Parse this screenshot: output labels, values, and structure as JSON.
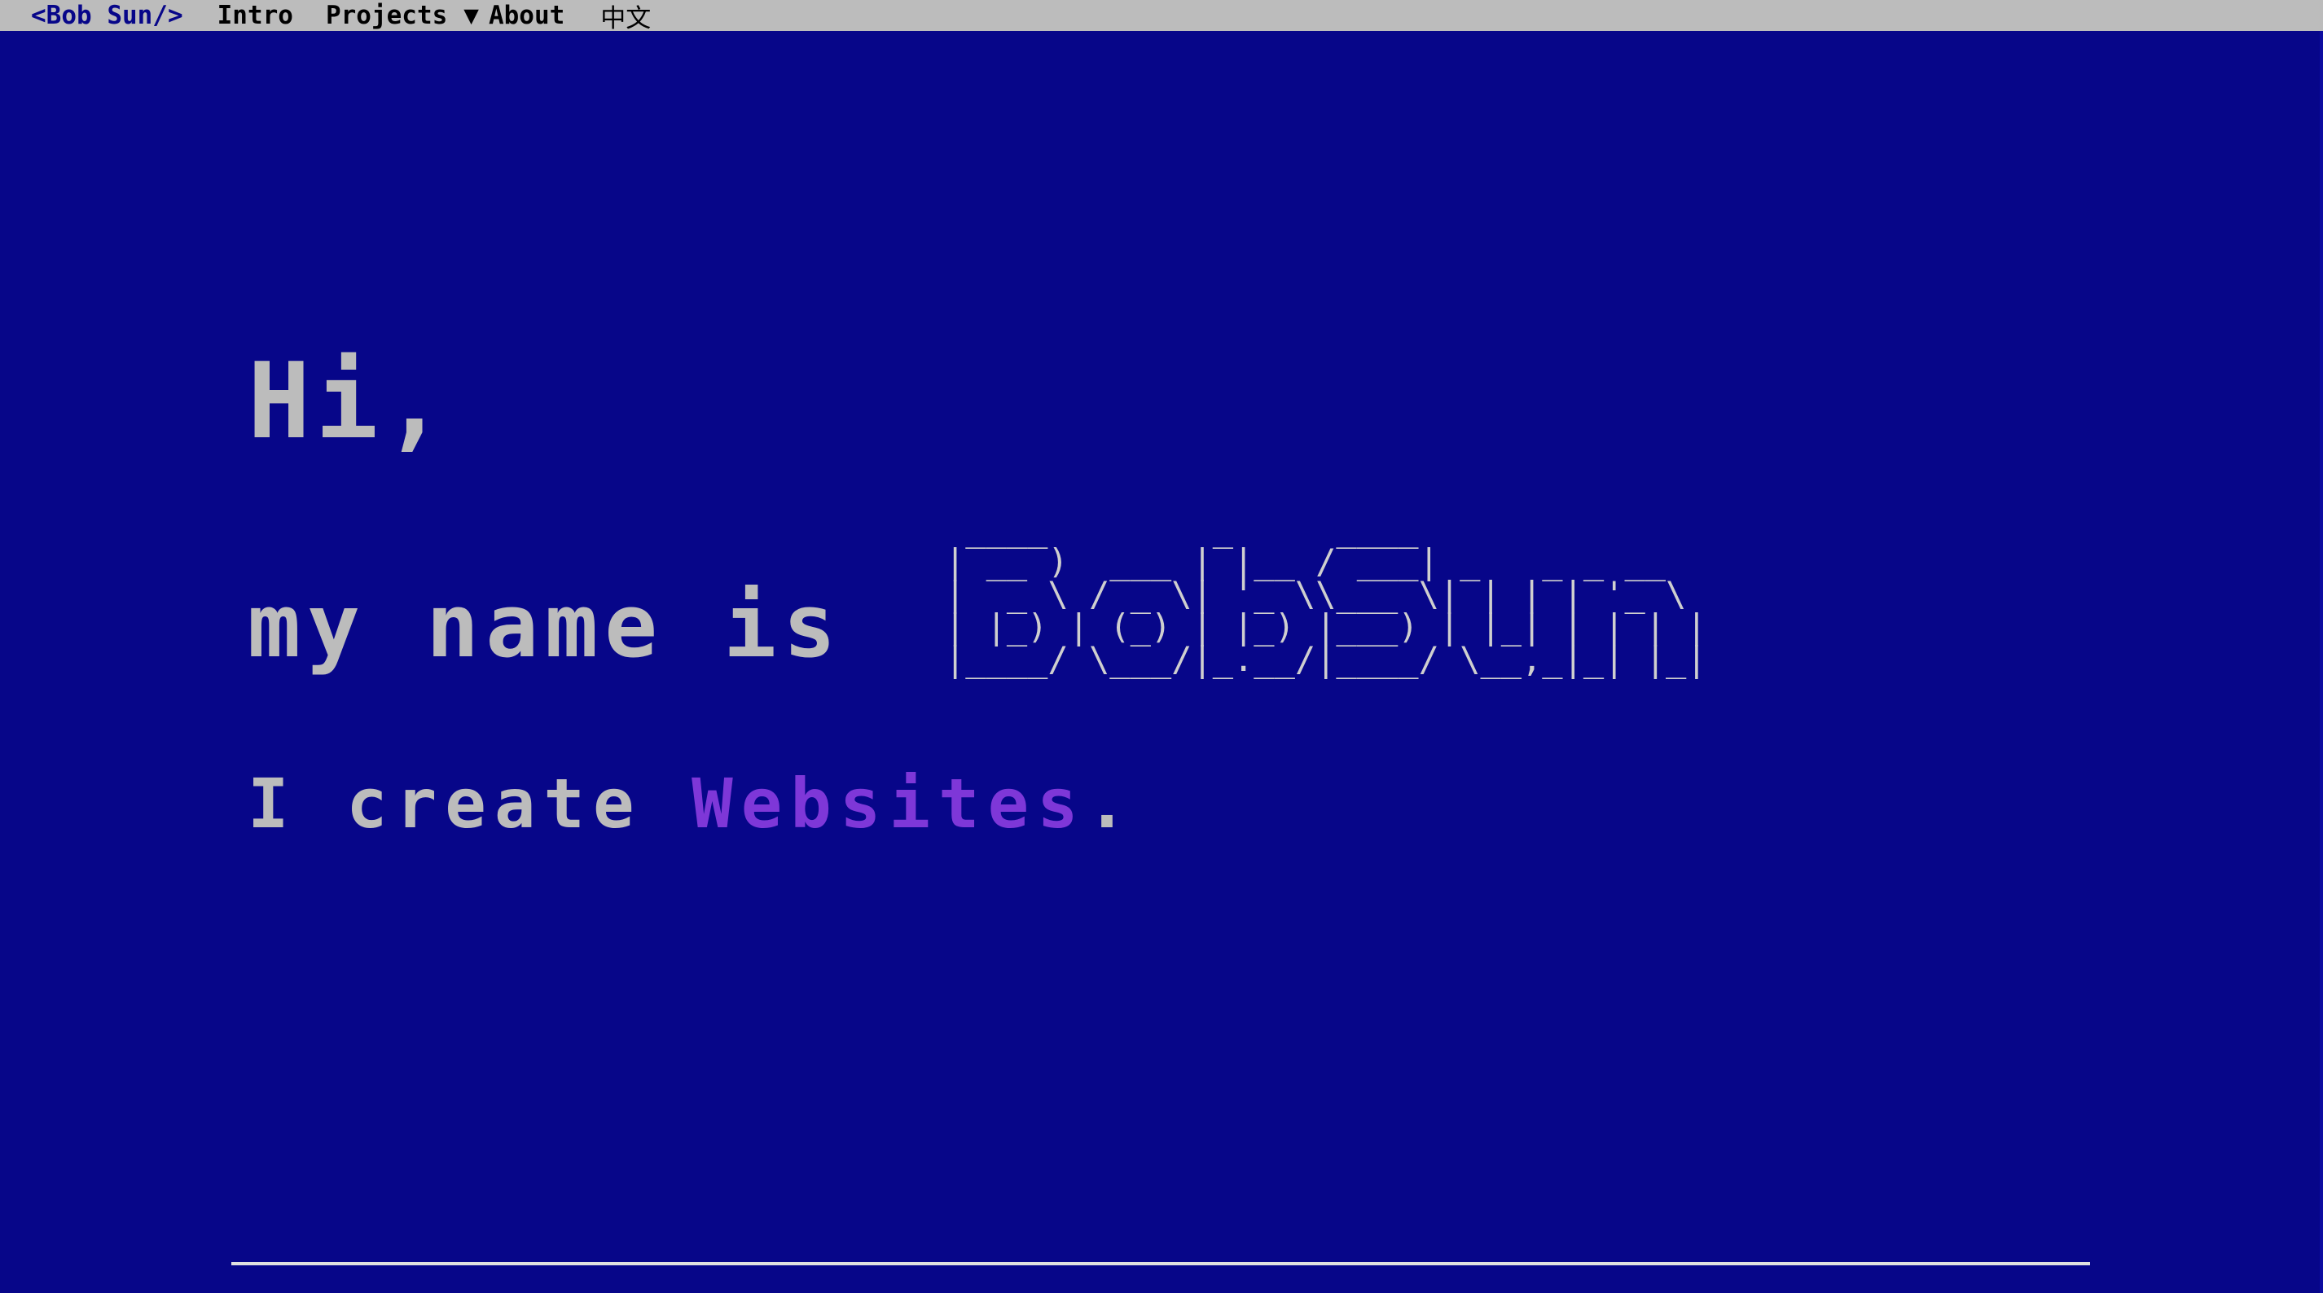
{
  "menubar": {
    "brand": "<Bob Sun/>",
    "items": [
      "Intro",
      "Projects",
      "About",
      "中文"
    ],
    "dropdown_indicator": "▼"
  },
  "hero": {
    "greeting": "Hi,",
    "intro_prefix": "my name is",
    "name": "Bob Sun",
    "name_ascii_art": " ____        _     ____\n| __ )  ___ | |__ / ___| _   _ _ __\n|  _ \\ / _ \\| '_ \\\\___ \\| | | | '_ \\\n| |_) | (_) | |_) |___) | |_| | | | |\n|____/ \\___/|_.__/|____/ \\__,_|_| |_|",
    "tagline_prefix": "I create ",
    "tagline_highlight": "Websites",
    "tagline_suffix": "."
  },
  "colors": {
    "background": "#070689",
    "menubar": "#bcbcbc",
    "text": "#bcbcbc",
    "accent": "#7e37d8"
  }
}
